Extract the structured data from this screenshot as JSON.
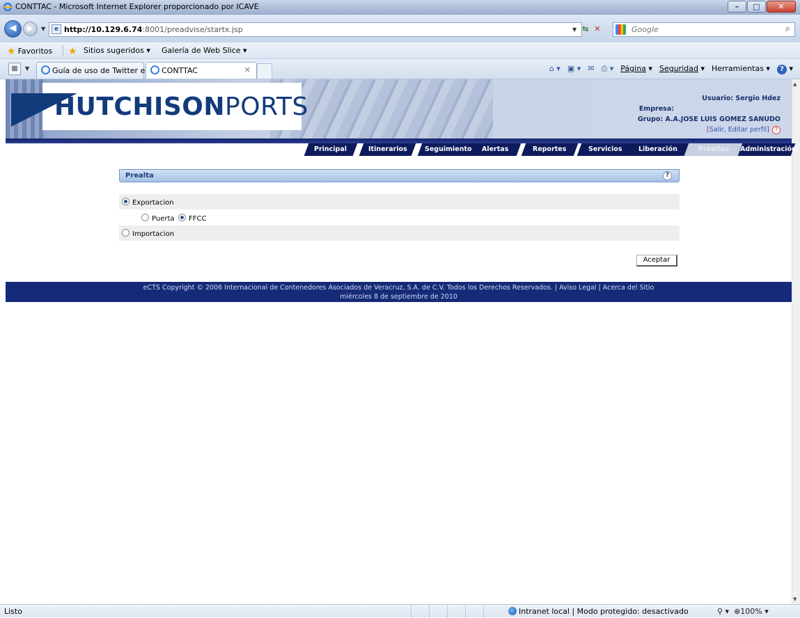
{
  "window": {
    "title": "CONTTAC - Microsoft Internet Explorer proporcionado por ICAVE",
    "minimize": "–",
    "maximize": "□",
    "close": "✕"
  },
  "address": {
    "url_host": "http://10.129.6.74",
    "url_rest": ":8001/preadvise/startx.jsp",
    "search_placeholder": "Google"
  },
  "favorites": {
    "favoritos": "Favoritos",
    "sitios": "Sitios sugeridos ▾",
    "galeria": "Galería de Web Slice ▾"
  },
  "tabs": [
    {
      "label": "Guía de uso de Twitter en I..."
    },
    {
      "label": "CONTTAC"
    }
  ],
  "commands": {
    "pagina": "Página",
    "seguridad": "Seguridad",
    "herramientas": "Herramientas"
  },
  "header": {
    "logo_bold": "HUTCHISON",
    "logo_light": "PORTS",
    "usuario": "Usuario: Sergio Hdez",
    "empresa": "Empresa:",
    "grupo": "Grupo: A.A.JOSE LUIS GOMEZ SANUDO",
    "salir": "Salir",
    "editar": "Editar perfil",
    "bracket_open": "[",
    "sep": ", ",
    "bracket_close": "]"
  },
  "menu": [
    {
      "label": "Principal",
      "active": false
    },
    {
      "label": "Itinerarios",
      "active": false
    },
    {
      "label": "Seguimiento",
      "active": false
    },
    {
      "label": "Alertas",
      "active": false
    },
    {
      "label": "Reportes",
      "active": false
    },
    {
      "label": "Servicios",
      "active": false
    },
    {
      "label": "Liberación",
      "active": false
    },
    {
      "label": "Prealtas",
      "active": true
    },
    {
      "label": "Administración",
      "active": false
    }
  ],
  "panel": {
    "title": "Prealta",
    "help": "?",
    "exportacion": "Exportacion",
    "puerta": "Puerta",
    "ffcc": "FFCC",
    "importacion": "Importacion",
    "aceptar": "Aceptar"
  },
  "footer": {
    "line1": "eCTS Copyright © 2006 Internacional de Contenedores Asociados de Veracruz, S.A. de C.V. Todos los Derechos Reservados. | Aviso Legal | Acerca del Sitio",
    "line2": "miércoles 8 de septiembre de 2010"
  },
  "status": {
    "left": "Listo",
    "zone": "Intranet local | Modo protegido: desactivado",
    "zoom": "100%"
  }
}
